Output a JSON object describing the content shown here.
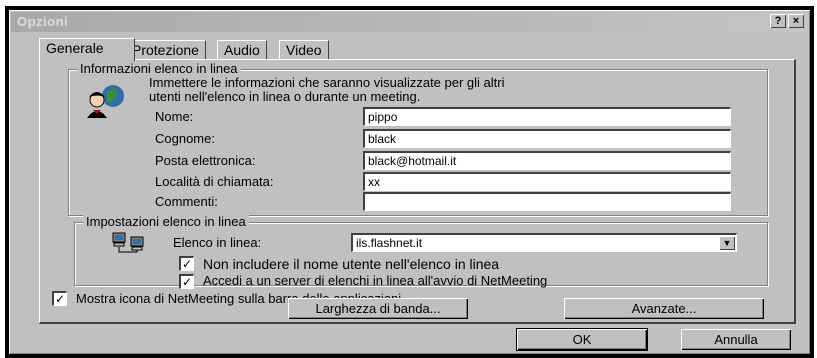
{
  "window": {
    "title": "Opzioni",
    "help_glyph": "?",
    "close_glyph": "×"
  },
  "tabs": [
    {
      "label": "Generale"
    },
    {
      "label": "Protezione"
    },
    {
      "label": "Audio"
    },
    {
      "label": "Video"
    }
  ],
  "directory_info": {
    "group_label": "Informazioni elenco in linea",
    "description_line1": "Immettere le informazioni che saranno visualizzate per gli altri",
    "description_line2": "utenti nell'elenco in linea o durante un meeting.",
    "fields": [
      {
        "label": "Nome:",
        "value": "pippo"
      },
      {
        "label": "Cognome:",
        "value": "black"
      },
      {
        "label": "Posta elettronica:",
        "value": "black@hotmail.it"
      },
      {
        "label": "Località di chiamata:",
        "value": "xx"
      },
      {
        "label": "Commenti:",
        "value": ""
      }
    ]
  },
  "directory_settings": {
    "group_label": "Impostazioni elenco in linea",
    "server_label": "Elenco in linea:",
    "server_value": "ils.flashnet.it",
    "check_exclude": {
      "label": "Non includere il nome utente nell'elenco in linea",
      "checked": true
    },
    "check_logon": {
      "label": "Accedi a un server di elenchi in linea all'avvio di NetMeeting",
      "checked": true
    }
  },
  "taskbar_check": {
    "label": "Mostra icona di NetMeeting sulla barra delle applicazioni",
    "checked": true
  },
  "buttons": {
    "bandwidth": "Larghezza di banda...",
    "advanced": "Avanzate...",
    "ok": "OK",
    "cancel": "Annulla"
  },
  "check_glyph": "✓"
}
